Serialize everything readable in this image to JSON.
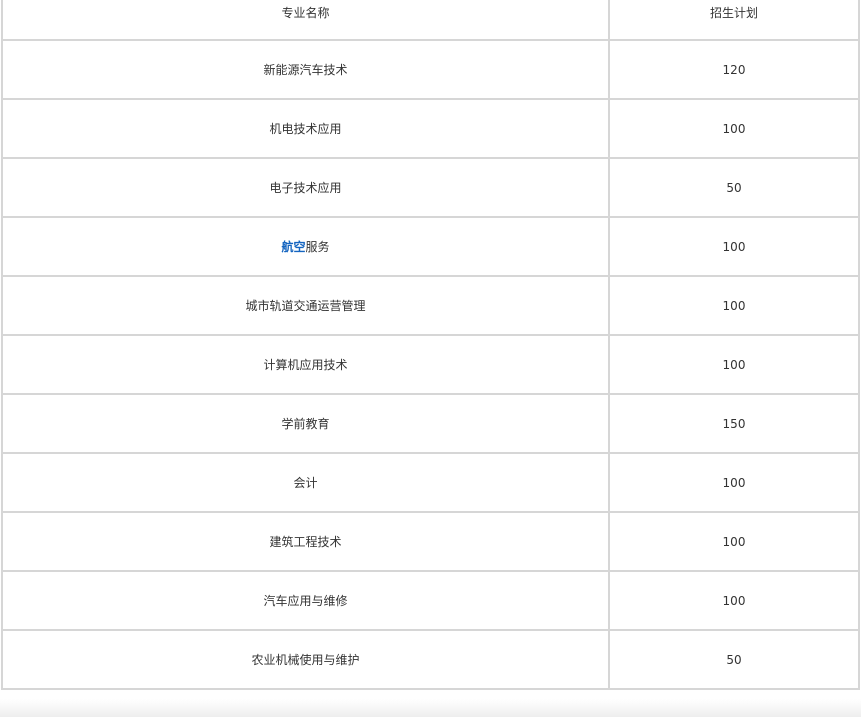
{
  "table": {
    "headers": {
      "major_name": "专业名称",
      "enrollment_plan": "招生计划"
    },
    "rows": [
      {
        "pre": "新能源汽车技术",
        "link": "",
        "post": "",
        "plan": "120"
      },
      {
        "pre": "机电技术应用",
        "link": "",
        "post": "",
        "plan": "100"
      },
      {
        "pre": "电子技术应用",
        "link": "",
        "post": "",
        "plan": "50"
      },
      {
        "pre": "",
        "link": "航空",
        "post": "服务",
        "plan": "100"
      },
      {
        "pre": "城市轨道交通运营管理",
        "link": "",
        "post": "",
        "plan": "100"
      },
      {
        "pre": "计算机应用技术",
        "link": "",
        "post": "",
        "plan": "100"
      },
      {
        "pre": "学前教育",
        "link": "",
        "post": "",
        "plan": "150"
      },
      {
        "pre": "会计",
        "link": "",
        "post": "",
        "plan": "100"
      },
      {
        "pre": "建筑工程技术",
        "link": "",
        "post": "",
        "plan": "100"
      },
      {
        "pre": "汽车应用与维修",
        "link": "",
        "post": "",
        "plan": "100"
      },
      {
        "pre": "农业机械使用与维护",
        "link": "",
        "post": "",
        "plan": "50"
      }
    ],
    "link_color": "#1565c0",
    "border_color": "#d6d6d6"
  }
}
